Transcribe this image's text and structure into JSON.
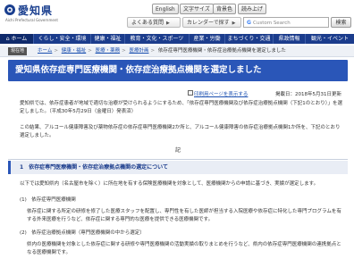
{
  "header": {
    "logo_title": "愛知県",
    "logo_sub": "Aichi Prefectural Government",
    "buttons": {
      "lang": "English",
      "font_size": "文字サイズ",
      "color": "背景色",
      "accessibility": "読み上げ",
      "faq": "よくある質問",
      "calendar": "カレンダーで探す",
      "ichiran": "一覧で探す"
    },
    "search": {
      "placeholder": "Custom Search",
      "button": "検索"
    }
  },
  "nav": {
    "items": [
      "ホーム",
      "くらし・安全・環境",
      "健康・福祉",
      "教育・文化・スポーツ",
      "産業・労働",
      "まちづくり・交通",
      "県政情報",
      "観光・イベント"
    ]
  },
  "breadcrumb": {
    "tag": "現在地",
    "items": [
      "ホーム",
      "健康・福祉",
      "医療・薬務",
      "医療計画",
      "依存症専門医療機関・依存症治療拠点機関を選定しました"
    ]
  },
  "page": {
    "title": "愛知県依存症専門医療機関・依存症治療拠点機関を選定しました",
    "print_link": "印刷用ページを表示する",
    "updated": "掲載日：2018年5月31日更新",
    "intro1": "愛知県では、依存症患者が地域で適切な治療が受けられるようにするため、「依存症専門医療機関及び依存症治療拠点機関（下記1のとおり）」を選定しました。（平成30年5月29日（金曜日）発表済）",
    "intro2": "この結果、アルコール健康障害及び薬物依存症の依存症専門医療機関2か所と、アルコール健康障害の依存症治療拠点機関1か所を、下記のとおり選定しました。",
    "center_mark": "記",
    "section1_title": "1　依存症専門医療機関・依存症治療拠点機関の選定について",
    "section1_text": "以下では愛知県内（名古屋市を除く）に所在地を有する保険医療機関を対象として、医療機関からの申請に基づき、実績が選定します。",
    "sub1_title": "(1)　依存症専門医療機関",
    "sub1_text": "依存症に関する所定の研修を修了した医療スタッフを配置し、専門性を有した医師が担当する入院医療や依存症に特化した専門プログラムを有する外来医療を行うなど、依存症に関する専門的な医療を提供できる医療機関です。",
    "sub2_title": "(2)　依存症治療拠点機関（専門医療機関の中から選定）",
    "sub2_text": "県内の医療機関を対象とした依存症に関する研修や専門医療機関の活動実績の取りまとめを行うなど、県内の依存症専門医療機関の連携拠点となる医療機関です。"
  },
  "colors": {
    "nav_bg": "#1b3c8c",
    "title_bg": "#2a56b8",
    "link": "#1a4fb0"
  }
}
